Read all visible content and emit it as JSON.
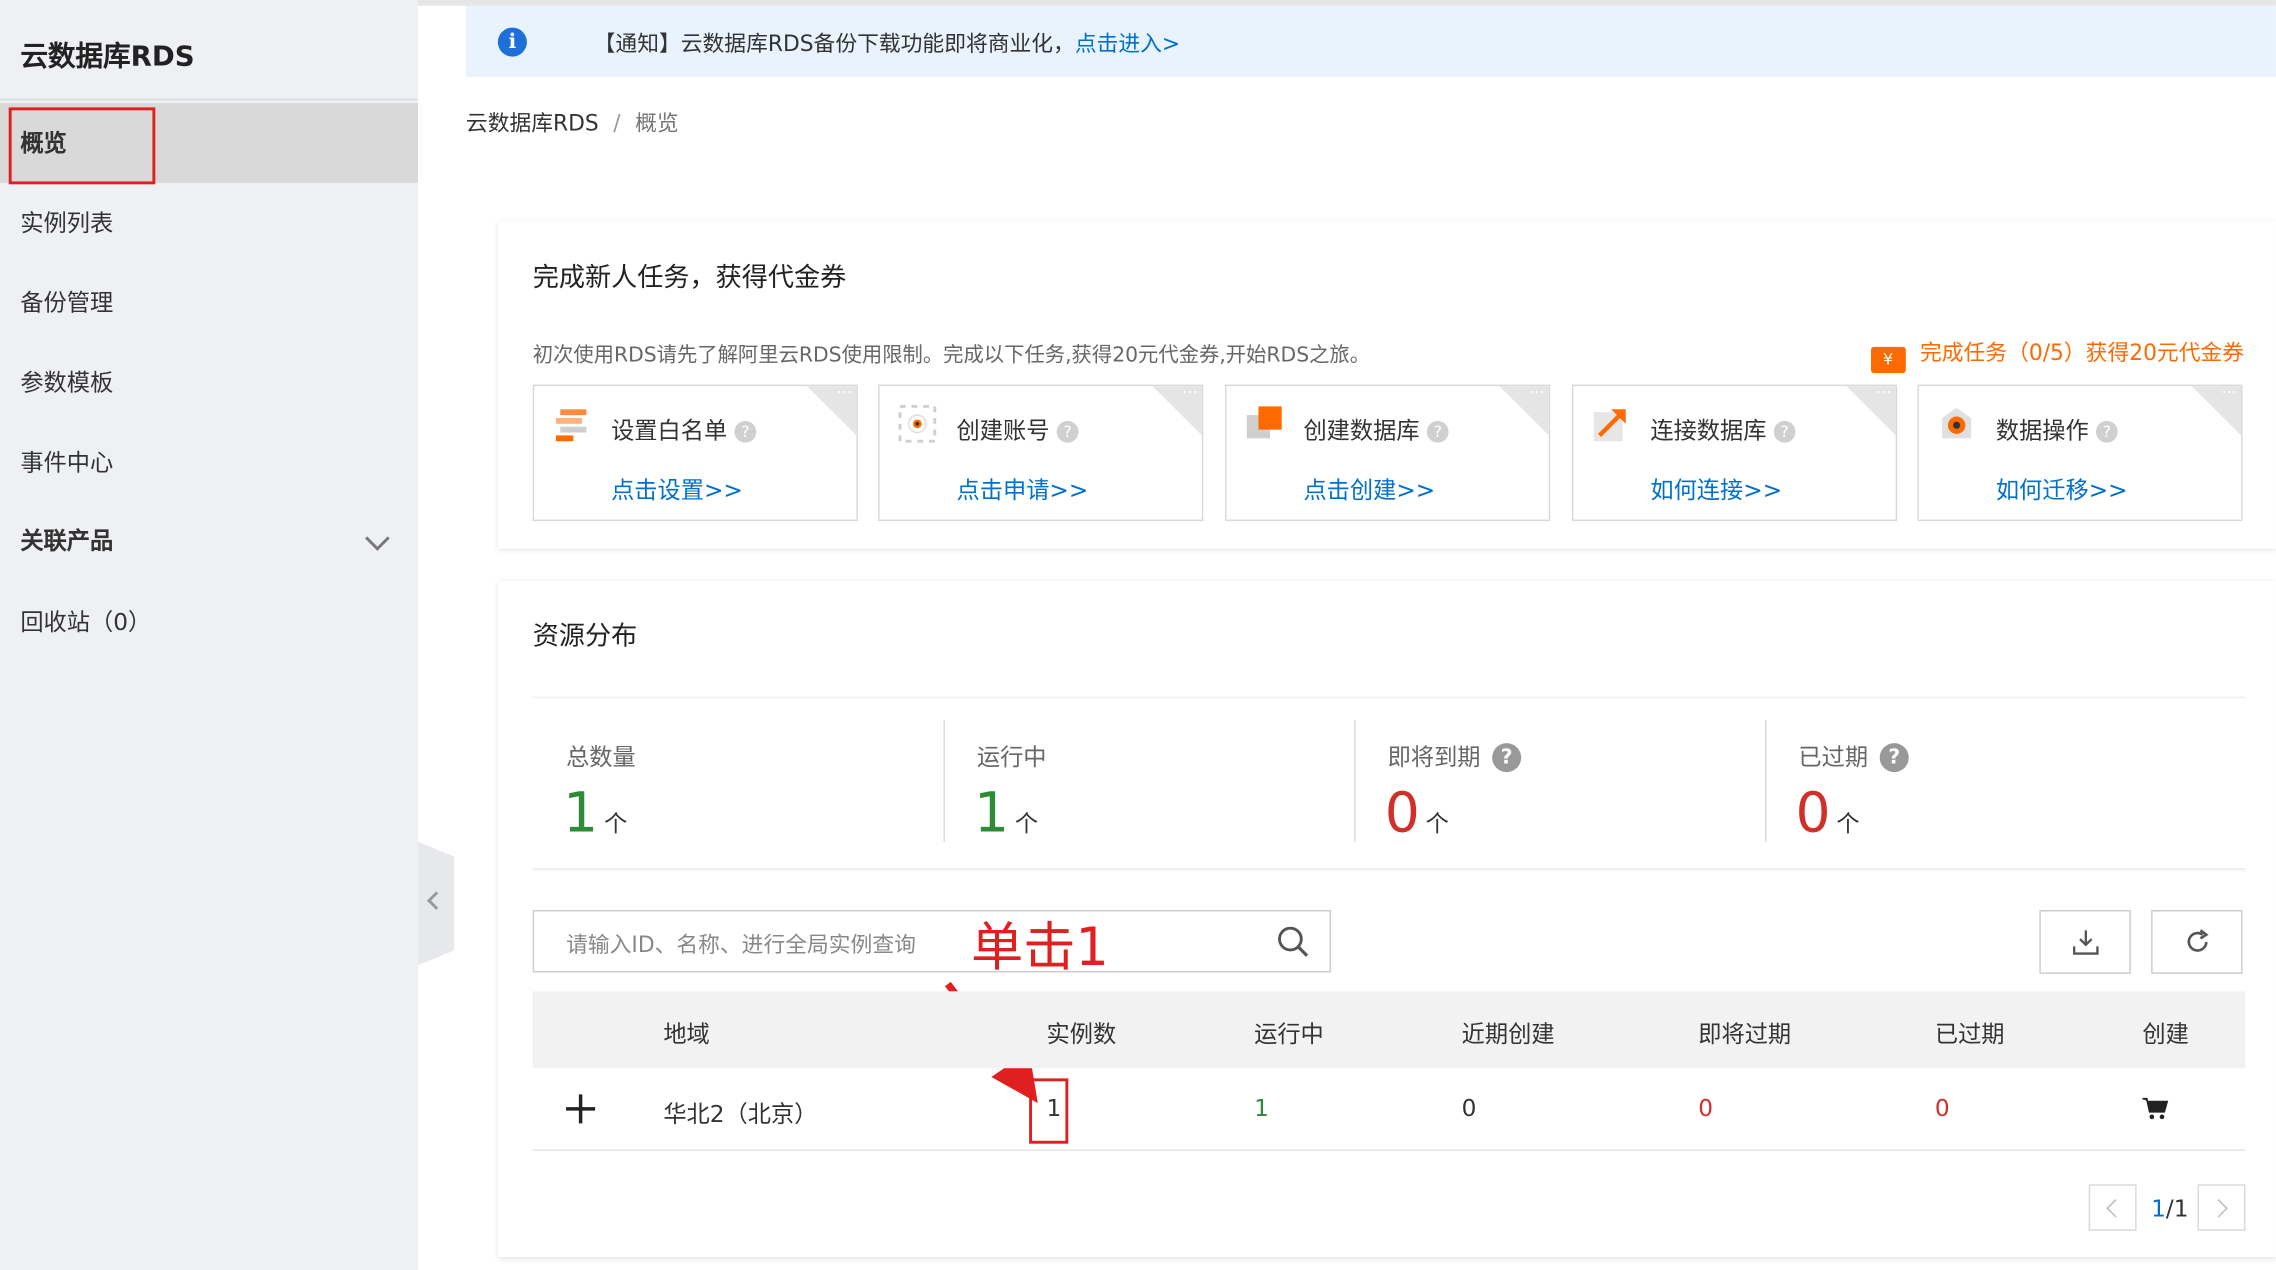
{
  "sidebar": {
    "title": "云数据库RDS",
    "items": [
      {
        "label": "概览"
      },
      {
        "label": "实例列表"
      },
      {
        "label": "备份管理"
      },
      {
        "label": "参数模板"
      },
      {
        "label": "事件中心"
      },
      {
        "label": "关联产品"
      },
      {
        "label": "回收站（0）"
      }
    ]
  },
  "notice": {
    "text": "【通知】云数据库RDS备份下载功能即将商业化，",
    "link": "点击进入>"
  },
  "breadcrumb": {
    "root": "云数据库RDS",
    "sep": "/",
    "current": "概览"
  },
  "tasks_card": {
    "title": "完成新人任务，获得代金券",
    "description": "初次使用RDS请先了解阿里云RDS使用限制。完成以下任务,获得20元代金券,开始RDS之旅。",
    "reward": "完成任务（0/5）获得20元代金券",
    "reward_icon_glyph": "¥",
    "help_glyph": "?",
    "dots": "···",
    "tasks": [
      {
        "label": "设置白名单",
        "link": "点击设置>>"
      },
      {
        "label": "创建账号",
        "link": "点击申请>>"
      },
      {
        "label": "创建数据库",
        "link": "点击创建>>"
      },
      {
        "label": "连接数据库",
        "link": "如何连接>>"
      },
      {
        "label": "数据操作",
        "link": "如何迁移>>"
      }
    ]
  },
  "resources": {
    "title": "资源分布",
    "unit": "个",
    "help_glyph": "?",
    "stats": [
      {
        "label": "总数量",
        "value": "1",
        "color": "#2e8b3a"
      },
      {
        "label": "运行中",
        "value": "1",
        "color": "#2e8b3a"
      },
      {
        "label": "即将到期",
        "value": "0",
        "color": "#d0302a"
      },
      {
        "label": "已过期",
        "value": "0",
        "color": "#d0302a"
      }
    ],
    "search_placeholder": "请输入ID、名称、进行全局实例查询",
    "annotation": "单击1",
    "table": {
      "headers": [
        "地域",
        "实例数",
        "运行中",
        "近期创建",
        "即将过期",
        "已过期",
        "创建"
      ],
      "rows": [
        {
          "region": "华北2（北京）",
          "instances": "1",
          "running": "1",
          "recent": "0",
          "expiring": "0",
          "expired": "0"
        }
      ]
    },
    "pager": {
      "current": "1",
      "total": "/1"
    }
  },
  "colors": {
    "accent_orange": "#ff6a00",
    "link_blue": "#0070cc",
    "annotation_red": "#e02020"
  }
}
